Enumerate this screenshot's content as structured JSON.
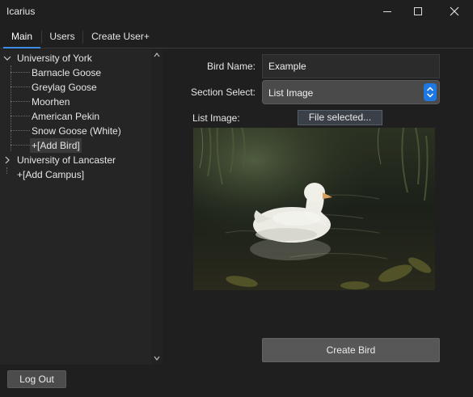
{
  "window": {
    "title": "Icarius"
  },
  "tabs": [
    {
      "label": "Main",
      "active": true
    },
    {
      "label": "Users",
      "active": false
    },
    {
      "label": "Create User+",
      "active": false
    }
  ],
  "tree": {
    "campuses": [
      {
        "label": "University of York",
        "expanded": true,
        "birds": [
          "Barnacle Goose",
          "Greylag Goose",
          "Moorhen",
          "American Pekin",
          "Snow Goose (White)"
        ],
        "add_bird": "+[Add Bird]"
      },
      {
        "label": "University of Lancaster",
        "expanded": false
      }
    ],
    "add_campus": "+[Add Campus]"
  },
  "form": {
    "bird_name_label": "Bird Name:",
    "bird_name_value": "Example",
    "section_select_label": "Section Select:",
    "section_select_value": "List Image",
    "list_image_label": "List Image:",
    "file_button_label": "File selected...",
    "create_button_label": "Create Bird"
  },
  "footer": {
    "logout_label": "Log Out"
  },
  "colors": {
    "accent": "#3d8ee6",
    "select_stepper": "#1e78e4",
    "background": "#1f1f1f"
  }
}
